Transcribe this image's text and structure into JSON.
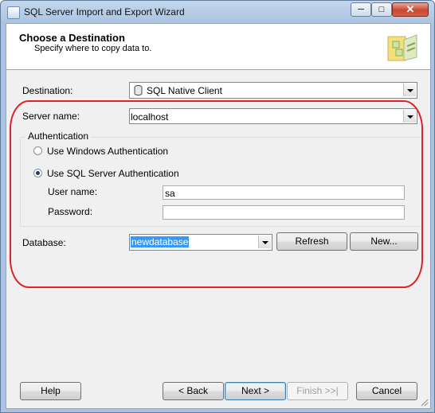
{
  "window": {
    "title": "SQL Server Import and Export Wizard",
    "controls": [
      "minimize-icon",
      "maximize-icon",
      "close-icon"
    ]
  },
  "header": {
    "title": "Choose a Destination",
    "subtitle": "Specify where to copy data to."
  },
  "form": {
    "destination_label": "Destination:",
    "destination_value": "SQL Native Client",
    "server_label": "Server name:",
    "server_value": "localhost",
    "auth_group_title": "Authentication",
    "windows_auth_label": "Use Windows Authentication",
    "sql_auth_label": "Use SQL Server Authentication",
    "selected_auth": "sql",
    "username_label": "User name:",
    "username_value": "sa",
    "password_label": "Password:",
    "password_value": "",
    "database_label": "Database:",
    "database_value": "newdatabase",
    "refresh_label": "Refresh",
    "new_label": "New..."
  },
  "footer": {
    "help_label": "Help",
    "back_label": "< Back",
    "next_label": "Next >",
    "finish_label": "Finish >>|",
    "cancel_label": "Cancel"
  },
  "colors": {
    "annotation_oval": "#e0202a",
    "selection": "#3399ff"
  }
}
